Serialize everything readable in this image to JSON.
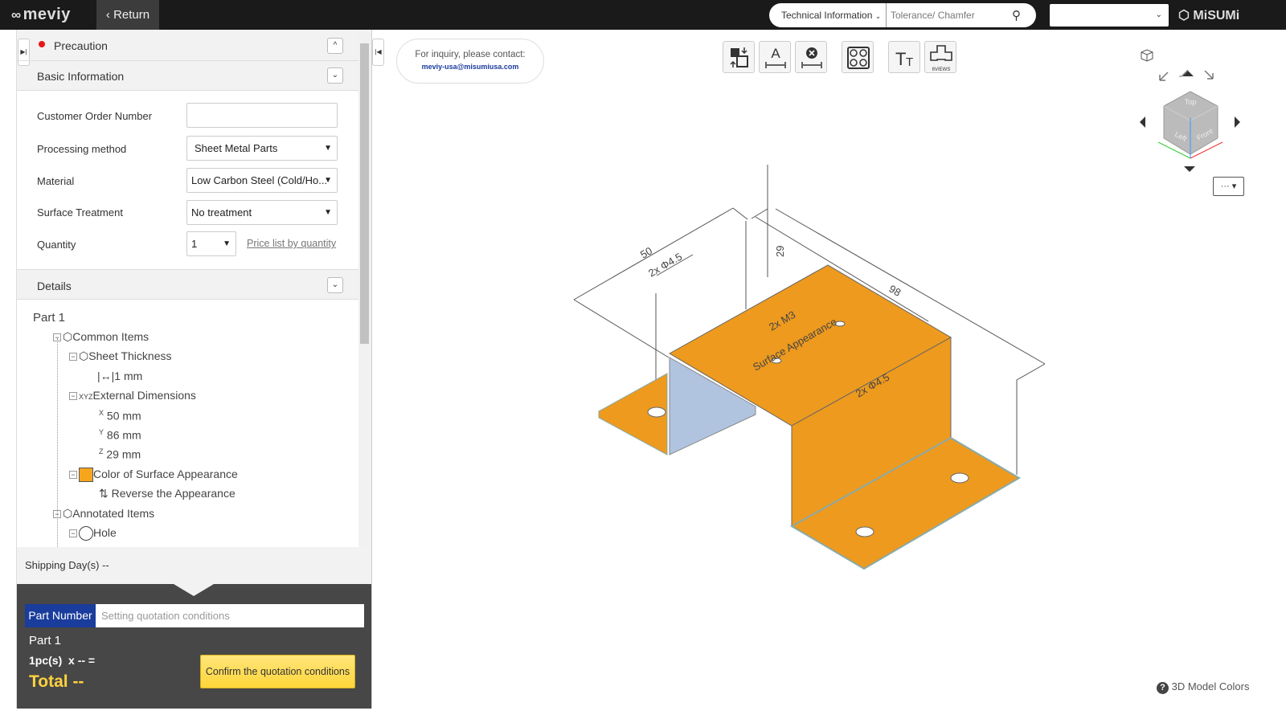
{
  "header": {
    "logo": "meviy",
    "return_label": "Return",
    "search_category": "Technical Information",
    "search_placeholder": "Tolerance/ Chamfer",
    "lang_select": "",
    "brand": "MiSUMi"
  },
  "panel": {
    "precaution": "Precaution",
    "basic_info": "Basic Information",
    "fields": [
      {
        "label": "Customer Order Number",
        "value": ""
      },
      {
        "label": "Processing method",
        "value": "Sheet Metal Parts"
      },
      {
        "label": "Material",
        "value": "Low Carbon Steel (Cold/Ho..."
      },
      {
        "label": "Surface Treatment",
        "value": "No treatment"
      },
      {
        "label": "Quantity",
        "value": "1"
      }
    ],
    "price_link": "Price list by quantity",
    "details": "Details",
    "tree": {
      "root": "Part 1",
      "common": "Common Items",
      "sheet_thickness": "Sheet Thickness",
      "thickness_value": "1 mm",
      "external_dimensions": "External Dimensions",
      "xyz": "XYZ",
      "x": "50 mm",
      "y": "86 mm",
      "z": "29 mm",
      "ax_x": "X",
      "ax_y": "Y",
      "ax_z": "Z",
      "color": "Color of Surface Appearance",
      "reverse": "Reverse the Appearance",
      "annotated": "Annotated Items",
      "hole": "Hole"
    },
    "shipping": "Shipping Day(s) --"
  },
  "quote": {
    "part_number_label": "Part Number",
    "part_number_placeholder": "Setting quotation conditions",
    "part": "Part 1",
    "qty_line": "1pc(s)  x -- =",
    "total": "Total --",
    "confirm": "Confirm the quotation conditions"
  },
  "viewer": {
    "inquiry": "For inquiry, please contact:",
    "email": "meviy-usa@misumiusa.com",
    "sixviews": "6VIEWS",
    "more": "···",
    "model_colors": "3D Model Colors",
    "dims": {
      "d50": "50",
      "hole1": "2x Φ4.5",
      "d29": "29",
      "d98": "98",
      "m3": "2x M3",
      "surface": "Surface Appearance",
      "hole2": "2x Φ4.5"
    },
    "cube": {
      "top": "Top",
      "left": "Left",
      "front": "Front"
    }
  },
  "colors": {
    "part": "#ED9A1E",
    "inner": "#B0C4E0",
    "accent_blue": "#1A3C9C",
    "confirm": "#FFD84A",
    "total": "#FFD23F",
    "precaution_dot": "#E81818"
  }
}
